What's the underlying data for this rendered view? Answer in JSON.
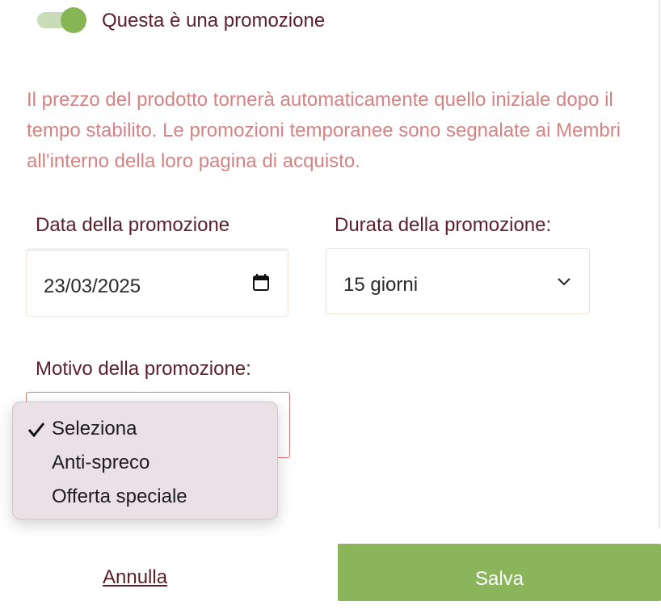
{
  "promotion_toggle": {
    "label": "Questa è una promozione",
    "state": "on",
    "color": "#86b554"
  },
  "info_text": "Il prezzo del prodotto tornerà automaticamente quello iniziale dopo il tempo stabilito. Le promozioni temporanee sono segnalate ai Membri all'interno della loro pagina di acquisto.",
  "date_field": {
    "label": "Data della promozione",
    "value": "23/03/2025",
    "icon": "calendar-icon"
  },
  "duration_field": {
    "label": "Durata della promozione:",
    "value": "15 giorni",
    "icon": "chevron-down-icon"
  },
  "reason_field": {
    "label": "Motivo della promozione:",
    "options": [
      "Seleziona",
      "Anti-spreco",
      "Offerta speciale"
    ],
    "selected": "Seleziona"
  },
  "actions": {
    "cancel_label": "Annulla",
    "save_label": "Salva"
  },
  "colors": {
    "primary_text": "#5a1f2c",
    "info_text": "#d48382",
    "accent_green": "#8ab55a",
    "error_border": "#d47a7a"
  }
}
